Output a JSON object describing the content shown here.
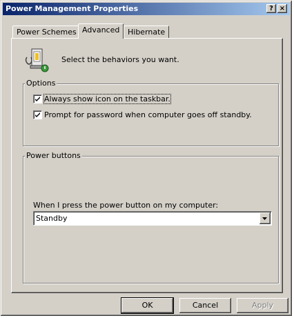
{
  "window": {
    "title": "Power Management Properties",
    "help_button": "?",
    "close_button": "×"
  },
  "tabs": [
    {
      "label": "Power Schemes",
      "active": false
    },
    {
      "label": "Advanced",
      "active": true
    },
    {
      "label": "Hibernate",
      "active": false
    }
  ],
  "advanced": {
    "icon": "power-settings-icon",
    "intro_text": "Select the behaviors you want.",
    "options": {
      "legend": "Options",
      "always_show_icon": {
        "label": "Always show icon on the taskbar.",
        "checked": true
      },
      "prompt_password": {
        "label": "Prompt for password when computer goes off standby.",
        "checked": true
      }
    },
    "power_buttons": {
      "legend": "Power buttons",
      "power_button_label": "When I press the power button on my computer:",
      "power_button_value": "Standby"
    }
  },
  "buttons": {
    "ok": "OK",
    "cancel": "Cancel",
    "apply": "Apply"
  },
  "colors": {
    "face": "#d4d0c8",
    "title_start": "#0a246a",
    "title_end": "#a6caf0"
  }
}
